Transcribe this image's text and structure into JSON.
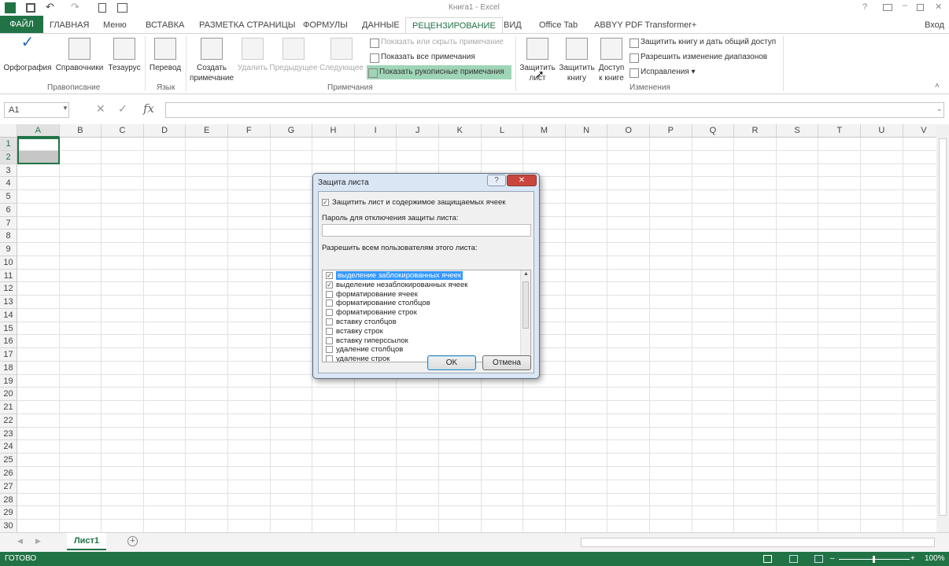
{
  "title": "Книга1 - Excel",
  "signin": "Вход",
  "ribbon_tabs": [
    "ФАЙЛ",
    "ГЛАВНАЯ",
    "Меню",
    "ВСТАВКА",
    "РАЗМЕТКА СТРАНИЦЫ",
    "ФОРМУЛЫ",
    "ДАННЫЕ",
    "РЕЦЕНЗИРОВАНИЕ",
    "ВИД",
    "Office Tab",
    "ABBYY PDF Transformer+"
  ],
  "active_tab": "РЕЦЕНЗИРОВАНИЕ",
  "ribbon": {
    "spelling": "Орфография",
    "research": "Справочники",
    "thesaurus": "Тезаурус",
    "grp_proofing": "Правописание",
    "translate": "Перевод",
    "grp_language": "Язык",
    "new_comment_1": "Создать",
    "new_comment_2": "примечание",
    "delete": "Удалить",
    "previous": "Предыдущее",
    "next": "Следующее",
    "show_hide_comment": "Показать или скрыть примечание",
    "show_all_comments": "Показать все примечания",
    "show_ink": "Показать рукописные примечания",
    "grp_comments": "Примечания",
    "protect_sheet_1": "Защитить",
    "protect_sheet_2": "лист",
    "protect_wb_1": "Защитить",
    "protect_wb_2": "книгу",
    "share_1": "Доступ",
    "share_2": "к книге",
    "protect_share": "Защитить книгу и дать общий доступ",
    "allow_ranges": "Разрешить изменение диапазонов",
    "track_changes": "Исправления",
    "grp_changes": "Изменения"
  },
  "name_box": "A1",
  "fx": "fx",
  "columns": [
    "A",
    "B",
    "C",
    "D",
    "E",
    "F",
    "G",
    "H",
    "I",
    "J",
    "K",
    "L",
    "M",
    "N",
    "O",
    "P",
    "Q",
    "R",
    "S",
    "T",
    "U",
    "V"
  ],
  "rows": [
    "1",
    "2",
    "3",
    "4",
    "5",
    "6",
    "7",
    "8",
    "9",
    "10",
    "11",
    "12",
    "13",
    "14",
    "15",
    "16",
    "17",
    "18",
    "19",
    "20",
    "21",
    "22",
    "23",
    "24",
    "25",
    "26",
    "27",
    "28",
    "29",
    "30"
  ],
  "sheet_tab": "Лист1",
  "status": "ГОТОВО",
  "zoom": "100%",
  "dialog": {
    "title": "Защита листа",
    "help": "?",
    "protect_label": "Защитить лист и содержимое защищаемых ячеек",
    "password_label": "Пароль для отключения защиты листа:",
    "password_value": "",
    "allow_label": "Разрешить всем пользователям этого листа:",
    "items": [
      {
        "label": "выделение заблокированных ячеек",
        "checked": true
      },
      {
        "label": "выделение незаблокированных ячеек",
        "checked": true
      },
      {
        "label": "форматирование ячеек",
        "checked": false
      },
      {
        "label": "форматирование столбцов",
        "checked": false
      },
      {
        "label": "форматирование строк",
        "checked": false
      },
      {
        "label": "вставку столбцов",
        "checked": false
      },
      {
        "label": "вставку строк",
        "checked": false
      },
      {
        "label": "вставку гиперссылок",
        "checked": false
      },
      {
        "label": "удаление столбцов",
        "checked": false
      },
      {
        "label": "удаление строк",
        "checked": false
      }
    ],
    "ok": "OK",
    "cancel": "Отмена"
  },
  "colors": {
    "excel_green": "#217346",
    "selection": "#3399ff"
  }
}
